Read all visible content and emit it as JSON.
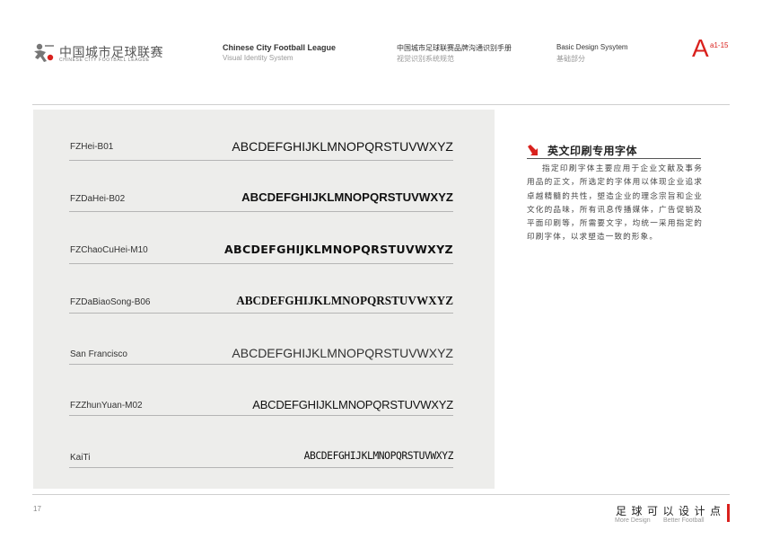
{
  "brand": {
    "logo_icon": "football-player-icon",
    "name_cn": "中国城市足球联赛",
    "name_en": "CHINESE CITY FOOTBALL LEAGUE"
  },
  "header": {
    "col1_title": "Chinese City Football League",
    "col1_sub": "Visual Identity System",
    "col2_title": "中国城市足球联赛品牌沟通识别手册",
    "col2_sub": "视觉识别系统规范",
    "col3_title": "Basic Design Sysytem",
    "col3_sub": "基础部分",
    "section_letter": "A",
    "page_code": "a1-15"
  },
  "sample_alphabet": "ABCDEFGHIJKLMNOPQRSTUVWXYZ",
  "fonts": [
    {
      "name": "FZHei-B01"
    },
    {
      "name": "FZDaHei-B02"
    },
    {
      "name": "FZChaoCuHei-M10"
    },
    {
      "name": "FZDaBiaoSong-B06"
    },
    {
      "name": "San Francisco"
    },
    {
      "name": "FZZhunYuan-M02"
    },
    {
      "name": "KaiTi"
    }
  ],
  "section": {
    "icon": "red-arrow-icon",
    "title": "英文印刷专用字体",
    "body": "指定印刷字体主要应用于企业文献及事务用品的正文，所选定的字体用以体现企业追求卓越精髓的共性，塑造企业的理念宗旨和企业文化的品味，所有讯息传播媒体，广告促销及平面印刷等，所需要文字，均统一采用指定的印刷字体，以求塑造一致的形象。"
  },
  "footer": {
    "page_number": "17",
    "slogan_cn": "足球可以设计点",
    "slogan_en_1": "More Design",
    "slogan_en_2": "Better Football"
  },
  "colors": {
    "accent": "#d9211d",
    "panel": "#ededeb"
  }
}
